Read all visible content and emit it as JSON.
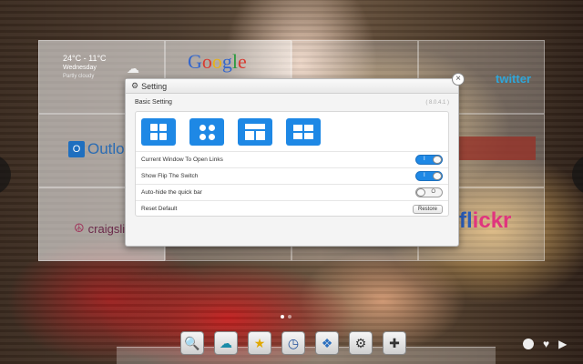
{
  "tiles": {
    "weather": {
      "temp": "24°C - 11°C",
      "day": "Wednesday",
      "desc": "Partly cloudy"
    },
    "google": [
      "G",
      "o",
      "o",
      "g",
      "l",
      "e"
    ],
    "twitter": "twitter",
    "outlook": "Outlook",
    "outlook_icon": "O",
    "craigslist": "craigslist",
    "flickr_b": "fl",
    "flickr_p": "ickr"
  },
  "modal": {
    "title": "Setting",
    "section_label": "Basic Setting",
    "version": "( 8.0.4.1 )",
    "close": "×",
    "layouts": [
      "layout-four-squares",
      "layout-four-circles",
      "layout-banner-grid",
      "layout-wide-grid"
    ],
    "options": [
      {
        "label": "Current Window To Open Links",
        "state": "on",
        "switch_text": "I"
      },
      {
        "label": "Show Flip The Switch",
        "state": "on",
        "switch_text": "I"
      },
      {
        "label": "Auto-hide the quick bar",
        "state": "off",
        "switch_text": "O"
      }
    ],
    "reset_label": "Reset Default",
    "restore_button": "Restore"
  },
  "pagination": {
    "count": 2,
    "active": 0
  },
  "quickbar": {
    "icons": [
      {
        "name": "search-icon",
        "glyph": "🔍"
      },
      {
        "name": "cloud-icon",
        "glyph": "☁"
      },
      {
        "name": "star-icon",
        "glyph": "★"
      },
      {
        "name": "clock-icon",
        "glyph": "◷"
      },
      {
        "name": "dropbox-icon",
        "glyph": "❖"
      },
      {
        "name": "gear-icon",
        "glyph": "⚙"
      },
      {
        "name": "plus-icon",
        "glyph": "✚"
      }
    ]
  },
  "corner": {
    "heart": "♥",
    "next": "▶"
  },
  "colors": {
    "accent": "#1e88e5"
  }
}
